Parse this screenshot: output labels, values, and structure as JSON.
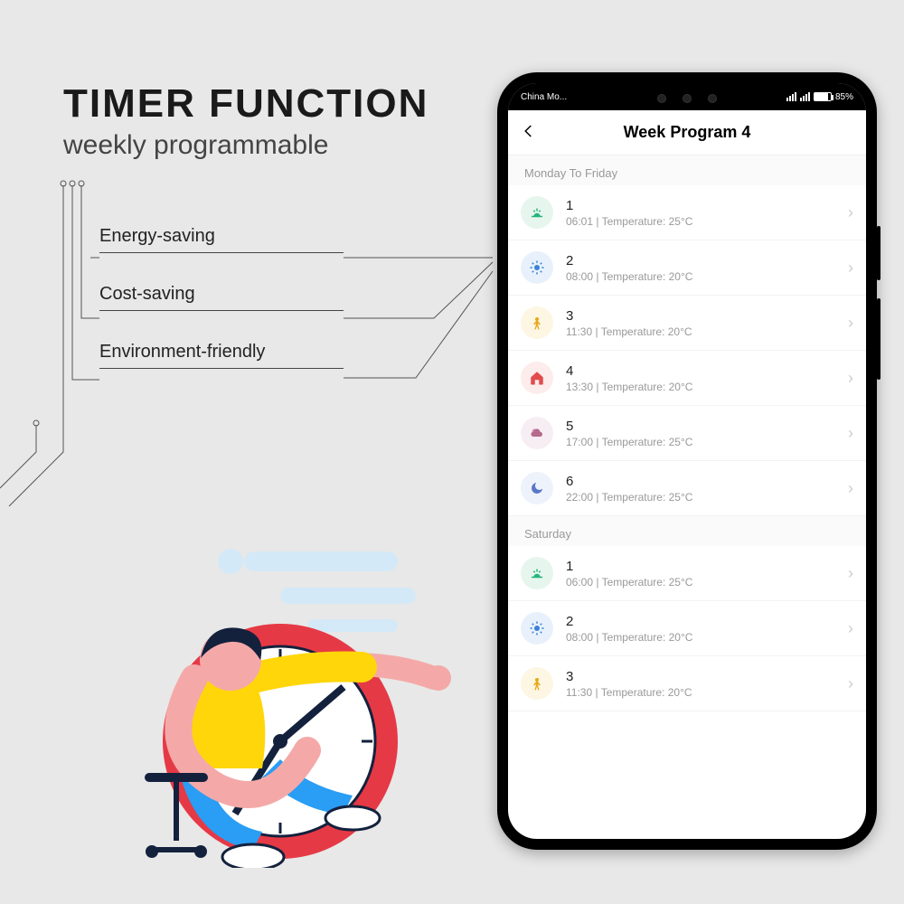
{
  "headline": {
    "title": "TIMER FUNCTION",
    "subtitle": "weekly programmable"
  },
  "bullets": [
    "Energy-saving",
    "Cost-saving",
    "Environment-friendly"
  ],
  "statusbar": {
    "carrier": "China Mo...",
    "battery": "85%"
  },
  "app": {
    "title": "Week Program 4",
    "sections": [
      {
        "header": "Monday To Friday",
        "rows": [
          {
            "num": "1",
            "time": "06:01",
            "temp": "25°C",
            "icon": "sunrise"
          },
          {
            "num": "2",
            "time": "08:00",
            "temp": "20°C",
            "icon": "sun"
          },
          {
            "num": "3",
            "time": "11:30",
            "temp": "20°C",
            "icon": "person"
          },
          {
            "num": "4",
            "time": "13:30",
            "temp": "20°C",
            "icon": "home"
          },
          {
            "num": "5",
            "time": "17:00",
            "temp": "25°C",
            "icon": "cloud"
          },
          {
            "num": "6",
            "time": "22:00",
            "temp": "25°C",
            "icon": "moon"
          }
        ]
      },
      {
        "header": "Saturday",
        "rows": [
          {
            "num": "1",
            "time": "06:00",
            "temp": "25°C",
            "icon": "sunrise"
          },
          {
            "num": "2",
            "time": "08:00",
            "temp": "20°C",
            "icon": "sun"
          },
          {
            "num": "3",
            "time": "11:30",
            "temp": "20°C",
            "icon": "person"
          }
        ]
      }
    ]
  },
  "labels": {
    "temp_prefix": "Temperature: ",
    "separator": "  |  "
  }
}
